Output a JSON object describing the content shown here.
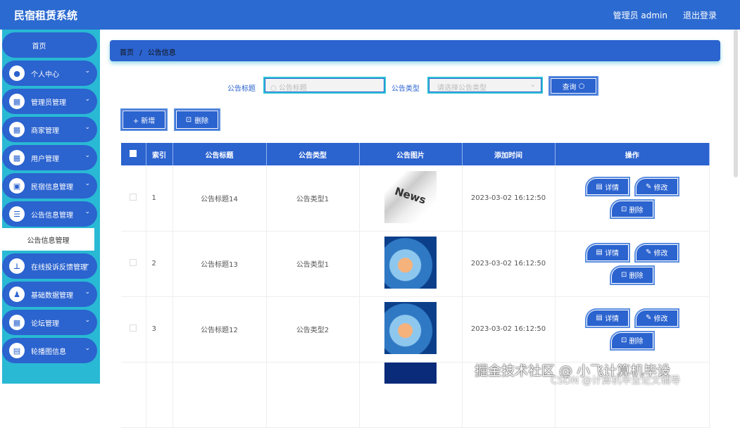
{
  "header": {
    "title": "民宿租赁系统",
    "user": "管理员 admin",
    "logout": "退出登录"
  },
  "sidebar": {
    "home": "首页",
    "items": [
      {
        "label": "个人中心",
        "icon": "user-icon"
      },
      {
        "label": "管理员管理",
        "icon": "grid-icon"
      },
      {
        "label": "商家管理",
        "icon": "grid-icon"
      },
      {
        "label": "用户管理",
        "icon": "grid-icon"
      },
      {
        "label": "民宿信息管理",
        "icon": "clipboard-icon"
      },
      {
        "label": "公告信息管理",
        "icon": "list-icon"
      },
      {
        "label": "在线投诉反馈管理",
        "icon": "stamp-icon"
      },
      {
        "label": "基础数据管理",
        "icon": "person-icon"
      },
      {
        "label": "论坛管理",
        "icon": "grid-icon"
      },
      {
        "label": "轮播图信息",
        "icon": "briefcase-icon"
      }
    ],
    "sub_item": "公告信息管理"
  },
  "breadcrumb": {
    "home": "首页",
    "sep": "/",
    "current": "公告信息"
  },
  "search": {
    "title_label": "公告标题",
    "title_placeholder": "公告标题",
    "type_label": "公告类型",
    "type_placeholder": "请选择公告类型",
    "query": "查询"
  },
  "actions": {
    "add": "+ 新增",
    "delete": "删除"
  },
  "table": {
    "columns": [
      "索引",
      "公告标题",
      "公告类型",
      "公告图片",
      "添加时间",
      "操作"
    ],
    "rows": [
      {
        "index": "1",
        "title": "公告标题14",
        "type": "公告类型1",
        "time": "2023-03-02 16:12:50"
      },
      {
        "index": "2",
        "title": "公告标题13",
        "type": "公告类型1",
        "time": "2023-03-02 16:12:50"
      },
      {
        "index": "3",
        "title": "公告标题12",
        "type": "公告类型2",
        "time": "2023-03-02 16:12:50"
      }
    ],
    "ops": {
      "detail": "详情",
      "edit": "修改",
      "delete": "删除"
    }
  },
  "watermark": {
    "line1": "掘金技术社区 @ 小飞计算机毕设",
    "line2": "CSDN @计算机毕业论文辅导"
  }
}
